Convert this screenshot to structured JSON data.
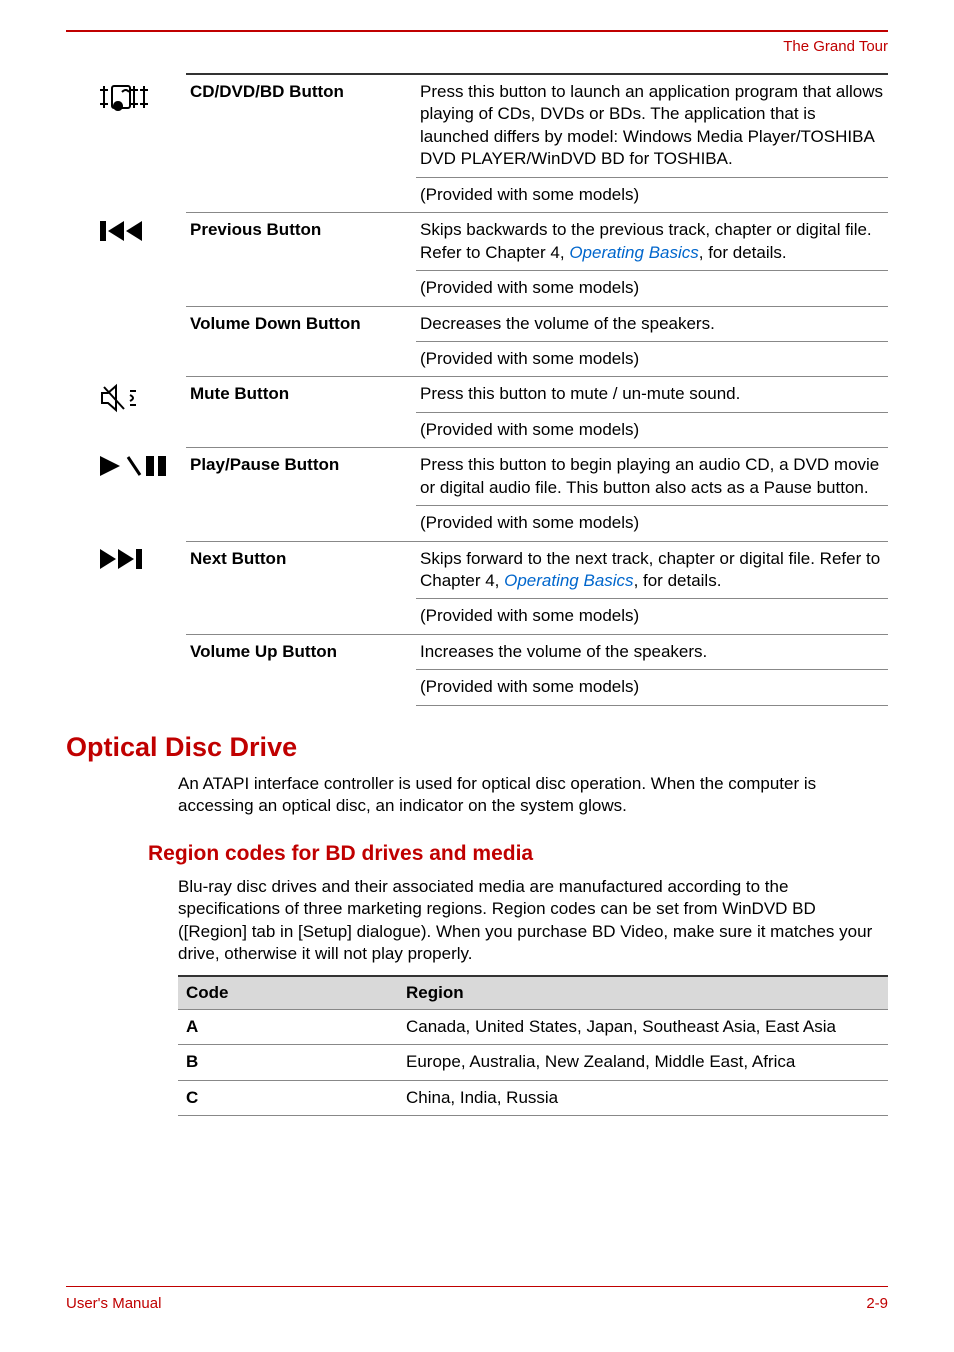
{
  "header": {
    "chapter": "The Grand Tour"
  },
  "buttons": [
    {
      "icon": "cd-dvd-bd-icon",
      "name": "CD/DVD/BD Button",
      "desc": "Press this button to launch an application program that allows playing of CDs, DVDs or BDs. The application that is launched differs by model: Windows Media Player/TOSHIBA DVD PLAYER/WinDVD BD for TOSHIBA.",
      "note": "(Provided with some models)"
    },
    {
      "icon": "previous-icon",
      "name": "Previous Button",
      "desc_pre": "Skips backwards to the previous track, chapter or digital file. Refer to Chapter 4, ",
      "desc_link": "Operating Basics",
      "desc_post": ", for details.",
      "note": "(Provided with some models)"
    },
    {
      "icon": "",
      "name": "Volume Down Button",
      "desc": "Decreases the volume of the speakers.",
      "note": "(Provided with some models)"
    },
    {
      "icon": "mute-icon",
      "name": "Mute Button",
      "desc": "Press this button to mute / un-mute sound.",
      "note": "(Provided with some models)"
    },
    {
      "icon": "play-pause-icon",
      "name": "Play/Pause Button",
      "desc": "Press this button to begin playing an audio CD, a DVD movie or digital audio file. This button also acts as a Pause button.",
      "note": "(Provided with some models)"
    },
    {
      "icon": "next-icon",
      "name": "Next Button",
      "desc_pre": "Skips forward to the next track, chapter or digital file. Refer to Chapter 4, ",
      "desc_link": "Operating Basics",
      "desc_post": ", for details.",
      "note": "(Provided with some models)"
    },
    {
      "icon": "",
      "name": "Volume Up Button",
      "desc": "Increases the volume of the speakers.",
      "note": "(Provided with some models)"
    }
  ],
  "section": {
    "heading": "Optical Disc Drive",
    "para": "An ATAPI interface controller is used for optical disc operation. When the computer is accessing an optical disc, an indicator on the system glows.",
    "sub_heading": "Region codes for BD drives and media",
    "sub_para": "Blu-ray disc drives and their associated media are manufactured according to the specifications of three marketing regions. Region codes can be set from WinDVD BD ([Region] tab in [Setup] dialogue). When you purchase BD Video, make sure it matches your drive, otherwise it will not play properly."
  },
  "region_table": {
    "head_code": "Code",
    "head_region": "Region",
    "rows": [
      {
        "code": "A",
        "region": "Canada, United States, Japan, Southeast Asia, East Asia"
      },
      {
        "code": "B",
        "region": "Europe, Australia, New Zealand, Middle East, Africa"
      },
      {
        "code": "C",
        "region": "China, India, Russia"
      }
    ]
  },
  "footer": {
    "left": "User's Manual",
    "right": "2-9"
  }
}
